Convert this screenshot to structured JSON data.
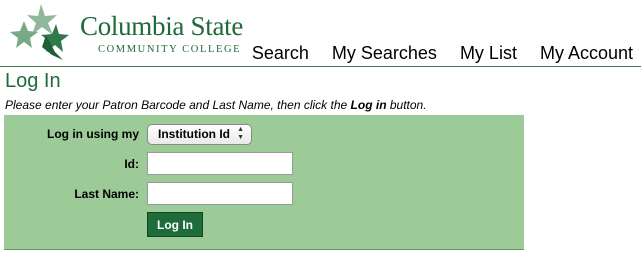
{
  "logo": {
    "name": "Columbia State",
    "subtitle": "COMMUNITY COLLEGE",
    "brand_color": "#1f6a3b",
    "icon": "leaves-icon"
  },
  "nav": {
    "items": [
      {
        "label": "Search"
      },
      {
        "label": "My Searches"
      },
      {
        "label": "My List"
      },
      {
        "label": "My Account"
      }
    ]
  },
  "page": {
    "title": "Log In",
    "instructions_prefix": "Please enter your Patron Barcode and Last Name, then click the ",
    "instructions_button": "Log in",
    "instructions_suffix": " button."
  },
  "form": {
    "panel_color": "#9ccb98",
    "login_using_label": "Log in using my",
    "login_using_value": "Institution Id",
    "id_label": "Id:",
    "id_value": "",
    "last_name_label": "Last Name:",
    "last_name_value": "",
    "submit_label": "Log In",
    "submit_color": "#1e6b3c"
  }
}
